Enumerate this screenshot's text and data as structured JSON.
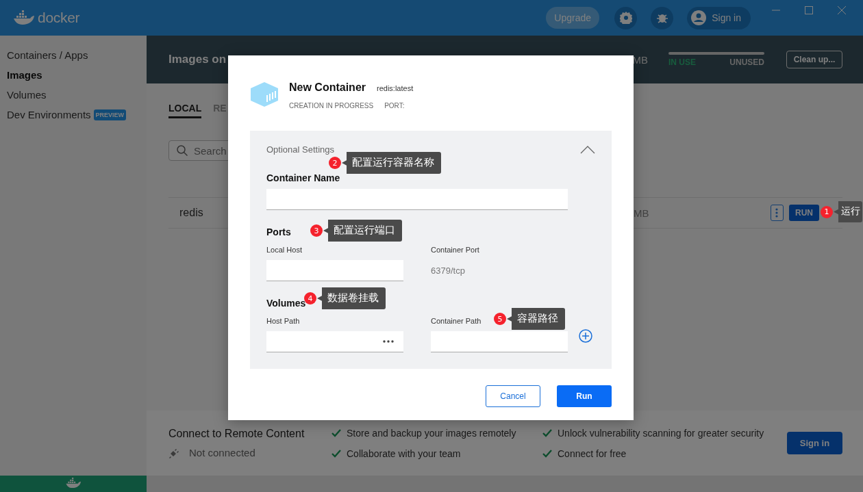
{
  "title_bar": {
    "logo_text": "docker",
    "upgrade": "Upgrade",
    "sign_in": "Sign in"
  },
  "sidebar": {
    "items": [
      {
        "label": "Containers / Apps",
        "selected": false
      },
      {
        "label": "Images",
        "selected": true
      },
      {
        "label": "Volumes",
        "selected": false
      },
      {
        "label": "Dev Environments",
        "badge": "PREVIEW",
        "selected": false
      }
    ]
  },
  "images_header": {
    "title": "Images on",
    "size": "MB",
    "in_use": "IN USE",
    "unused": "UNUSED",
    "clean_up": "Clean up..."
  },
  "tabs": [
    {
      "label": "LOCAL",
      "selected": true
    },
    {
      "label": "RE",
      "selected": false
    }
  ],
  "search": {
    "placeholder": "Search"
  },
  "images": [
    {
      "name": "redis",
      "size": "MB",
      "run": "RUN"
    }
  ],
  "remote": {
    "title": "Connect to Remote Content",
    "status": "Not connected",
    "features": [
      "Store and backup your images remotely",
      "Unlock vulnerability scanning for greater security",
      "Collaborate with your team",
      "Connect for free"
    ],
    "sign_in": "Sign in"
  },
  "dialog": {
    "title": "New Container",
    "image": "redis:latest",
    "status": "CREATION IN PROGRESS",
    "port_label": "PORT:",
    "section": "Optional Settings",
    "expanded": true,
    "container_name": {
      "label": "Container Name"
    },
    "ports": {
      "heading": "Ports",
      "local_label": "Local Host",
      "container_label": "Container Port",
      "container_value": "6379/tcp"
    },
    "volumes": {
      "heading": "Volumes",
      "host_label": "Host Path",
      "container_label": "Container Path"
    },
    "buttons": {
      "cancel": "Cancel",
      "run": "Run"
    }
  },
  "annotations": [
    {
      "number": "1",
      "text": "运行"
    },
    {
      "number": "2",
      "text": "配置运行容器名称"
    },
    {
      "number": "3",
      "text": "配置运行端口"
    },
    {
      "number": "4",
      "text": "数据卷挂载"
    },
    {
      "number": "5",
      "text": "容器路径"
    }
  ]
}
